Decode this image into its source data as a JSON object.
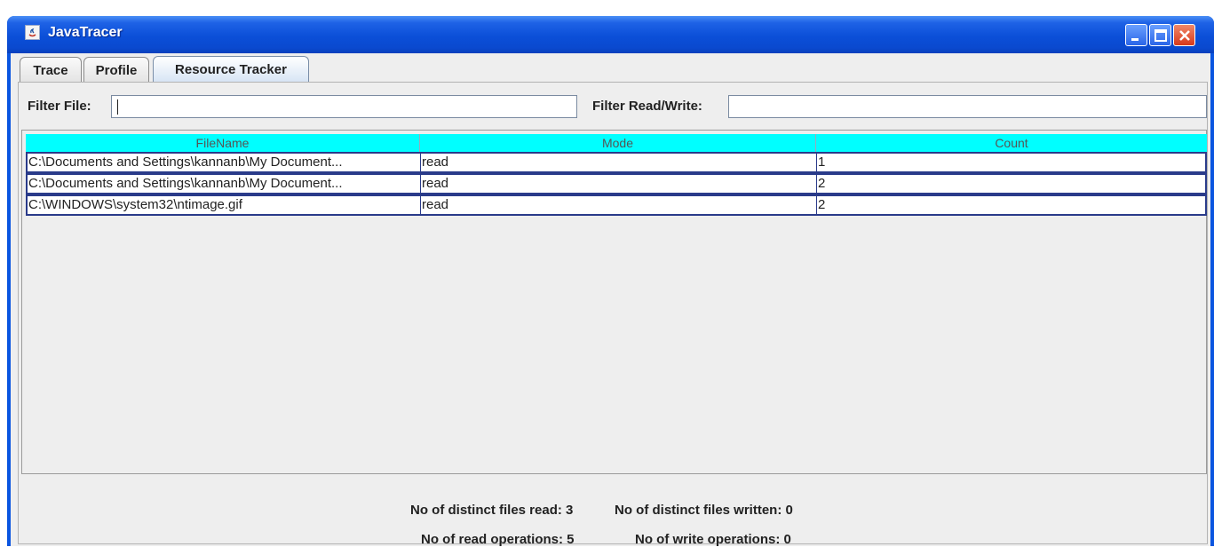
{
  "window": {
    "title": "JavaTracer"
  },
  "tabs": [
    {
      "label": "Trace"
    },
    {
      "label": "Profile"
    },
    {
      "label": "Resource Tracker"
    }
  ],
  "filters": {
    "file_label": "Filter File:",
    "file_value": "",
    "rw_label": "Filter Read/Write:",
    "rw_value": ""
  },
  "table": {
    "columns": [
      "FileName",
      "Mode",
      "Count"
    ],
    "rows": [
      {
        "file": "C:\\Documents and Settings\\kannanb\\My Document...",
        "mode": "read",
        "count": "1"
      },
      {
        "file": "C:\\Documents and Settings\\kannanb\\My Document...",
        "mode": "read",
        "count": "2"
      },
      {
        "file": "C:\\WINDOWS\\system32\\ntimage.gif",
        "mode": "read",
        "count": "2"
      }
    ]
  },
  "stats": {
    "distinct_read": "No of distinct files read: 3",
    "distinct_written": "No of distinct files written: 0",
    "read_ops": "No of read operations: 5",
    "write_ops": "No of write operations: 0"
  },
  "icons": [
    "java-icon",
    "minimize-icon",
    "maximize-icon",
    "close-icon"
  ],
  "colors": {
    "title_bar": "#0b4fd8",
    "header_bg": "#00ffff",
    "row_border": "#2a3b8a",
    "close_button": "#d8391b"
  }
}
